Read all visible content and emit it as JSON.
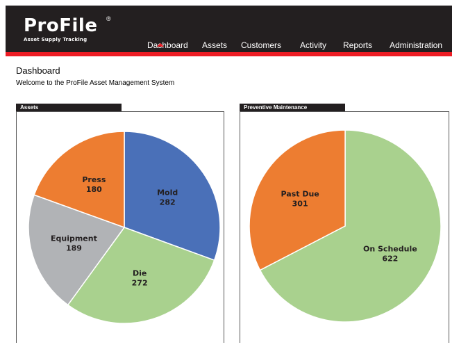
{
  "header": {
    "logo_text": "ProFile",
    "logo_mark": "®",
    "tagline": "Asset Supply Tracking",
    "nav": [
      {
        "label": "Dashboard",
        "active": true
      },
      {
        "label": "Assets",
        "active": false
      },
      {
        "label": "Customers",
        "active": false
      },
      {
        "label": "Activity",
        "active": false
      },
      {
        "label": "Reports",
        "active": false
      },
      {
        "label": "Administration",
        "active": false
      }
    ],
    "accent_color": "#ed1c24",
    "bar_color": "#231f20"
  },
  "page": {
    "title": "Dashboard",
    "welcome": "Welcome to the ProFile Asset Management System"
  },
  "chart_data": [
    {
      "type": "pie",
      "title": "Assets",
      "categories": [
        "Mold",
        "Die",
        "Equipment",
        "Press"
      ],
      "values": [
        282,
        272,
        189,
        180
      ],
      "colors": [
        "#4a70b8",
        "#a9d18e",
        "#b1b3b6",
        "#ed7d31"
      ]
    },
    {
      "type": "pie",
      "title": "Preventive Maintenance",
      "categories": [
        "On Schedule",
        "Past Due"
      ],
      "values": [
        622,
        301
      ],
      "colors": [
        "#a9d18e",
        "#ed7d31"
      ]
    }
  ]
}
